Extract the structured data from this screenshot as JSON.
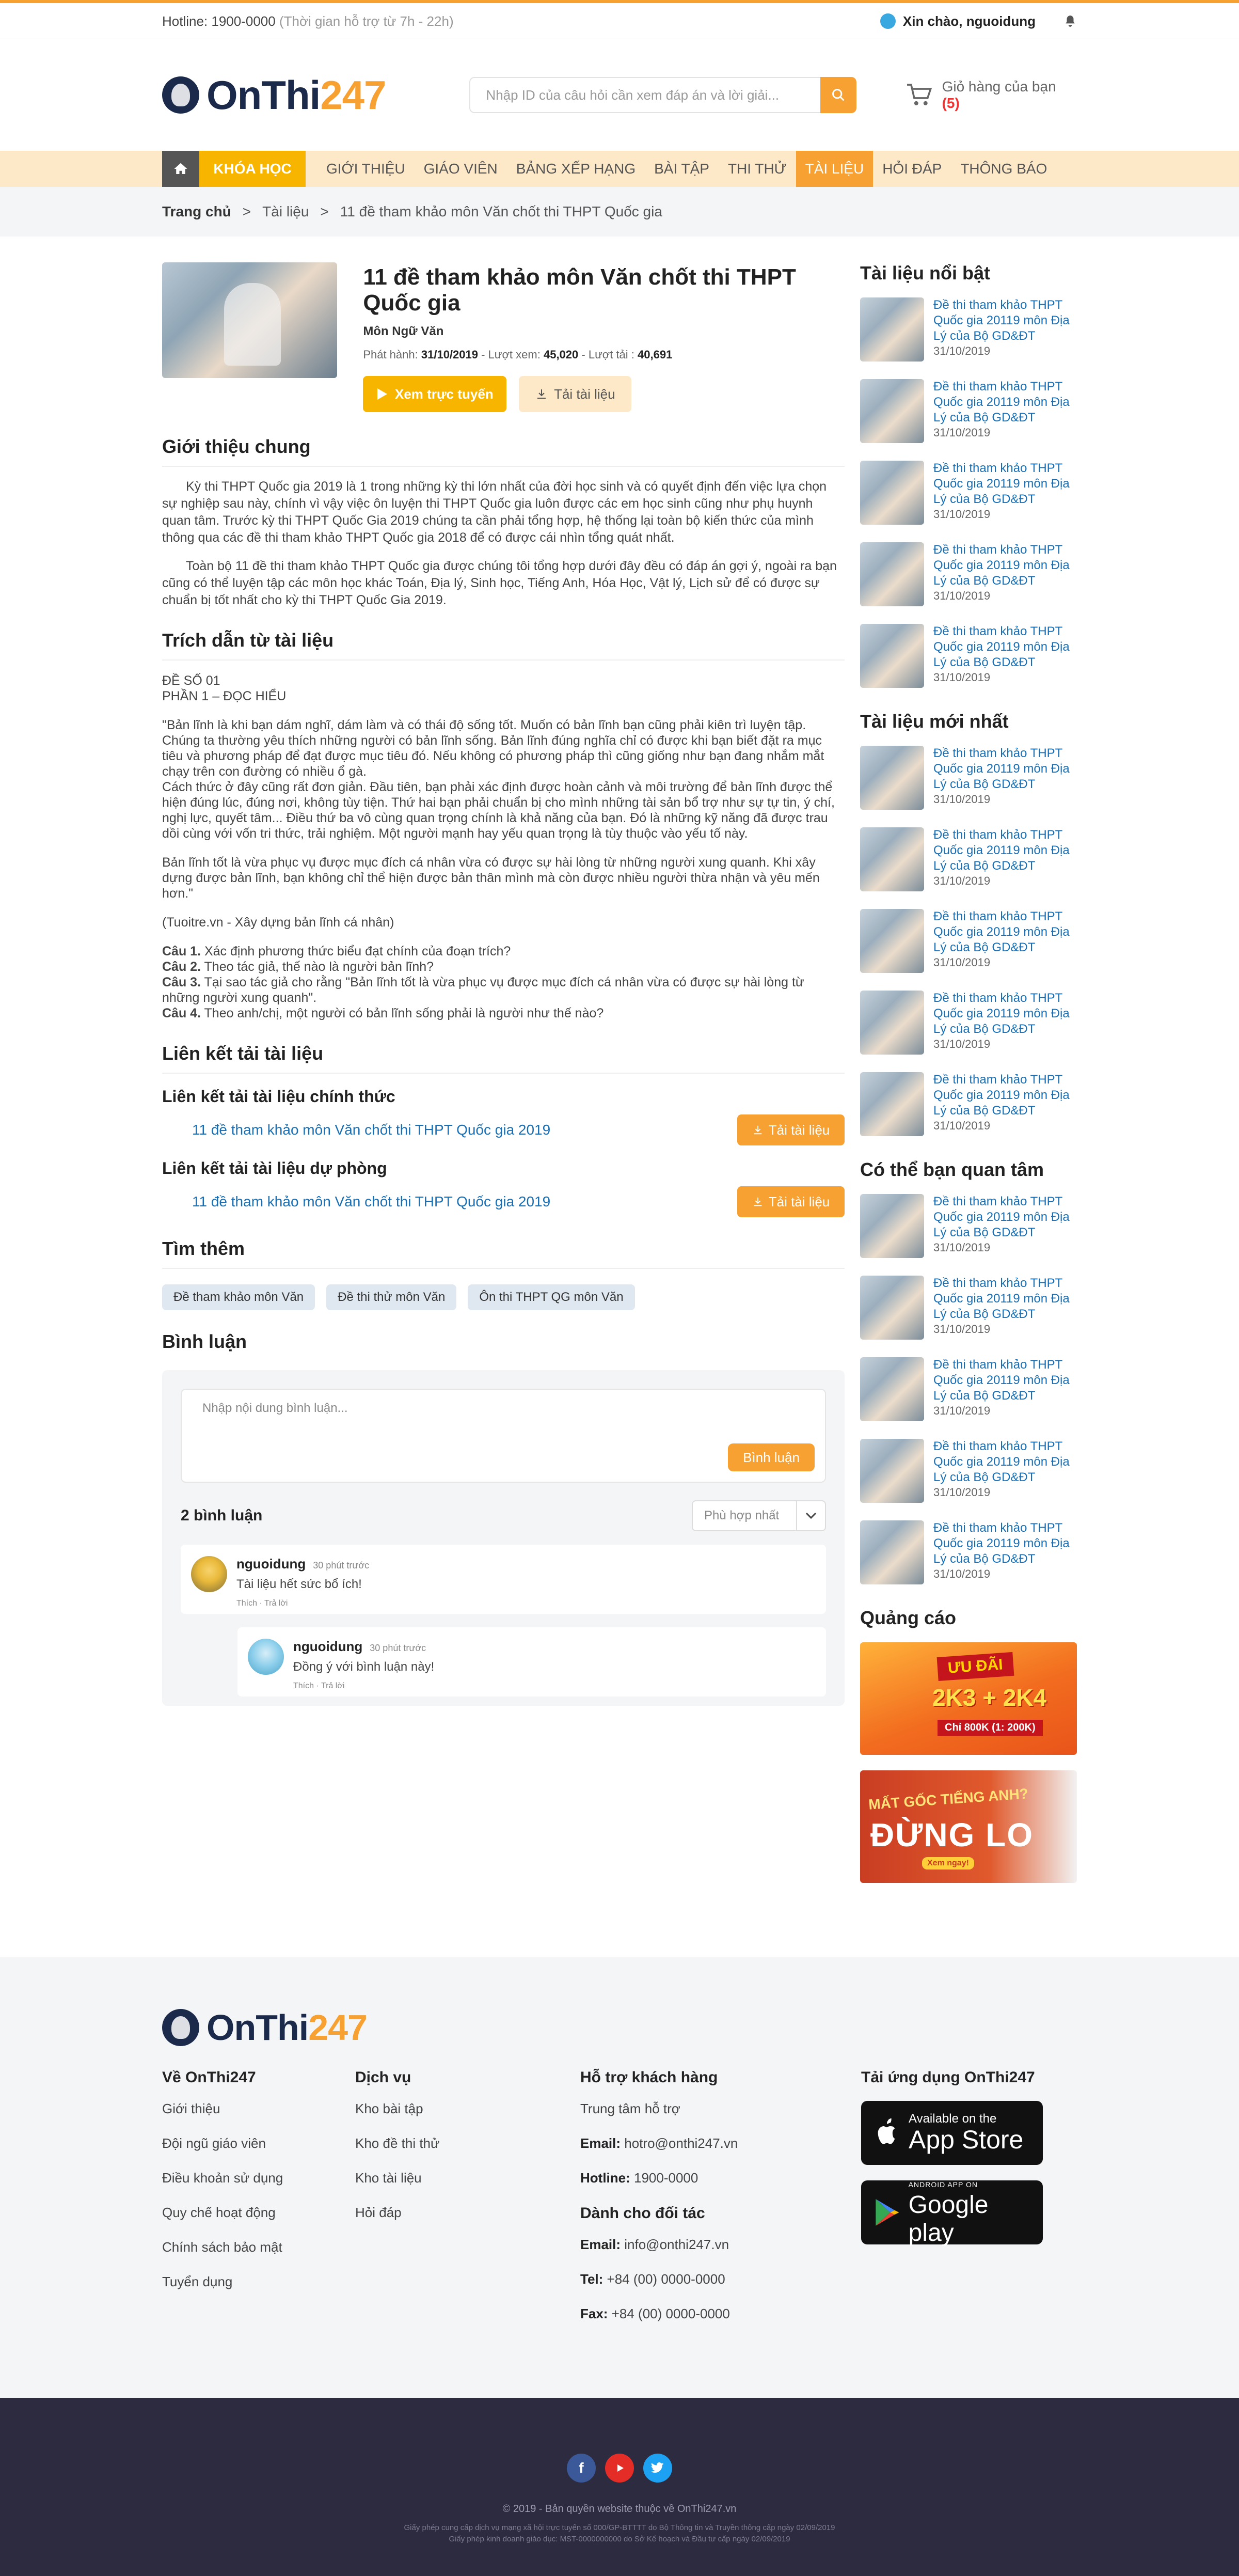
{
  "topbar": {
    "hotline_label": "Hotline: 1900-0000",
    "hotline_hours": "(Thời gian hỗ trợ từ 7h - 22h)",
    "greeting": "Xin chào, nguoidung"
  },
  "header": {
    "logo_text": "OnThi",
    "logo_num": "247",
    "search_placeholder": "Nhập ID của câu hỏi cần xem đáp án và lời giải...",
    "cart_label": "Giỏ hàng của bạn",
    "cart_count": "(5)"
  },
  "nav": {
    "category": "KHÓA HỌC",
    "items": [
      "GIỚI THIỆU",
      "GIÁO VIÊN",
      "BẢNG XẾP HẠNG",
      "BÀI TẬP",
      "THI THỬ",
      "TÀI LIỆU",
      "HỎI ĐÁP",
      "THÔNG BÁO"
    ],
    "active": "TÀI LIỆU"
  },
  "breadcrumb": {
    "home": "Trang chủ",
    "section": "Tài liệu",
    "current": "11 đề tham khảo môn Văn chốt thi THPT Quốc gia"
  },
  "doc": {
    "title": "11 đề tham khảo môn Văn chốt thi THPT Quốc gia",
    "subject": "Môn Ngữ Văn",
    "published_label": "Phát hành:",
    "published": "31/10/2019",
    "views_label": "Lượt xem:",
    "views": "45,020",
    "downloads_label": "Lượt tải :",
    "downloads": "40,691",
    "view_button": "Xem trực tuyến",
    "download_button": "Tải tài liệu"
  },
  "intro": {
    "title": "Giới thiệu chung",
    "p1": "Kỳ thi THPT Quốc gia 2019 là 1 trong những kỳ thi lớn nhất của đời học sinh và có quyết định đến việc lựa chọn sự nghiệp sau này, chính vì vậy việc ôn luyện thi THPT Quốc gia luôn được các em học sinh cũng như phụ huynh quan tâm. Trước kỳ thi THPT Quốc Gia 2019 chúng ta cần phải tổng hợp, hệ thống lại toàn bộ kiến thức của mình thông qua các đề thi tham khảo THPT Quốc gia 2018 để có được cái nhìn tổng quát nhất.",
    "p2": "Toàn bộ 11 đề thi tham khảo THPT Quốc gia được chúng tôi tổng hợp dưới đây đều có đáp án gợi ý, ngoài ra bạn cũng có thể luyện tập các môn học khác Toán, Địa lý, Sinh học, Tiếng Anh, Hóa Học, Vật lý, Lịch sử để có được sự chuẩn bị tốt nhất cho kỳ thi THPT Quốc Gia 2019."
  },
  "excerpt": {
    "title": "Trích dẫn từ tài liệu",
    "l1": "ĐỀ SỐ 01",
    "l2": "PHẦN 1 – ĐỌC HIỂU",
    "p1": "\"Bản lĩnh là khi bạn dám nghĩ, dám làm và có thái độ sống tốt. Muốn có bản lĩnh bạn cũng phải kiên trì luyện tập. Chúng ta thường yêu thích những người có bản lĩnh sống. Bản lĩnh đúng nghĩa chỉ có được khi bạn biết đặt ra mục tiêu và phương pháp để đạt được mục tiêu đó. Nếu không có phương pháp thì cũng giống như bạn đang nhắm mắt chạy trên con đường có nhiều ổ gà.",
    "p2": "Cách thức ở đây cũng rất đơn giản. Đầu tiên, bạn phải xác định được hoàn cảnh và môi trường để bản lĩnh được thể hiện đúng lúc, đúng nơi, không tùy tiện. Thứ hai bạn phải chuẩn bị cho mình những tài sản bổ trợ như sự tự tin, ý chí, nghị lực, quyết tâm... Điều thứ ba vô cùng quan trọng chính là khả năng của bạn. Đó là những kỹ năng đã được trau dồi cùng với vốn tri thức, trải nghiệm. Một người mạnh hay yếu quan trọng là tùy thuộc vào yếu tố này.",
    "p3": "Bản lĩnh tốt là vừa phục vụ được mục đích cá nhân vừa có được sự hài lòng từ những người xung quanh. Khi xây dựng được bản lĩnh, bạn không chỉ thể hiện được bản thân mình mà còn được nhiều người thừa nhận và yêu mến hơn.\"",
    "source": "(Tuoitre.vn - Xây dựng bản lĩnh cá nhân)",
    "questions": [
      {
        "n": "Câu 1.",
        "t": " Xác định phương thức biểu đạt chính của đoạn trích?"
      },
      {
        "n": "Câu 2.",
        "t": " Theo tác giả, thế nào là người bản lĩnh?"
      },
      {
        "n": "Câu 3.",
        "t": " Tại sao tác giả cho rằng \"Bản lĩnh tốt là vừa phục vụ được mục đích cá nhân vừa có được sự hài lòng từ những người xung quanh\"."
      },
      {
        "n": "Câu 4.",
        "t": " Theo anh/chị, một người có bản lĩnh sống phải là người như thế nào?"
      }
    ]
  },
  "links": {
    "title": "Liên kết tải tài liệu",
    "official_title": "Liên kết tải tài liệu chính thức",
    "official_link": "11 đề tham khảo môn Văn chốt thi THPT Quốc gia 2019",
    "backup_title": "Liên kết tải tài liệu dự phòng",
    "backup_link": "11 đề tham khảo môn Văn chốt thi THPT Quốc gia 2019",
    "button": "Tải tài liệu"
  },
  "more": {
    "title": "Tìm thêm",
    "tags": [
      "Đề tham khảo môn Văn",
      "Đề thi thử môn Văn",
      "Ôn thi THPT QG môn Văn"
    ]
  },
  "comments": {
    "title": "Bình luận",
    "placeholder": "Nhập nội dung bình luận...",
    "send": "Bình luận",
    "count": "2 bình luận",
    "sort": "Phù hợp nhất",
    "items": [
      {
        "user": "nguoidung",
        "time": "30 phút trước",
        "text": "Tài liệu hết sức bổ ích!",
        "like": "Thích",
        "reply": "Trả lời"
      },
      {
        "user": "nguoidung",
        "time": "30 phút trước",
        "text": "Đồng ý với bình luận này!",
        "like": "Thích",
        "reply": "Trả lời"
      }
    ]
  },
  "sidebar": {
    "featured_title": "Tài liệu nổi bật",
    "latest_title": "Tài liệu mới nhất",
    "maybe_title": "Có thể bạn quan tâm",
    "ads_title": "Quảng cáo",
    "item_title": "Đề thi tham khảo THPT Quốc gia 20119 môn Địa Lý của Bộ GD&ĐT",
    "item_date": "31/10/2019",
    "ad1": {
      "t1": "ƯU ĐÃI",
      "t2": "2K3 + 2K4",
      "t3": "Chỉ 800K (1: 200K)"
    },
    "ad2": {
      "t1": "MẤT GỐC TIẾNG ANH?",
      "t2": "ĐỪNG LO",
      "t3": "Xem ngay!"
    }
  },
  "footer": {
    "about_title": "Về OnThi247",
    "about": [
      "Giới thiệu",
      "Đội ngũ giáo viên",
      "Điều khoản sử dụng",
      "Quy chế hoạt động",
      "Chính sách bảo mật",
      "Tuyển dụng"
    ],
    "service_title": "Dịch vụ",
    "services": [
      "Kho bài tập",
      "Kho đề thi thử",
      "Kho tài liệu",
      "Hỏi đáp"
    ],
    "support_title": "Hỗ trợ khách hàng",
    "support_center": "Trung tâm hỗ trợ",
    "email_label": "Email:",
    "email": "hotro@onthi247.vn",
    "hotline_label": "Hotline:",
    "hotline": "1900-0000",
    "partner_title": "Dành cho đối tác",
    "p_email_label": "Email:",
    "p_email": "info@onthi247.vn",
    "tel_label": "Tel:",
    "tel": "+84 (00) 0000-0000",
    "fax_label": "Fax:",
    "fax": "+84 (00) 0000-0000",
    "app_title": "Tải ứng dụng OnThi247",
    "appstore_small": "Available on the",
    "appstore_big": "App Store",
    "gplay_small": "ANDROID APP ON",
    "gplay_big": "Google play",
    "copyright": "© 2019 - Bản quyền website thuộc về OnThi247.vn",
    "lic1": "Giấy phép cung cấp dịch vụ mạng xã hội trực tuyến số 000/GP-BTTTT do Bộ Thông tin và Truyền thông cấp ngày 02/09/2019",
    "lic2": "Giấy phép kinh doanh giáo dục: MST-0000000000 do Sở Kế hoạch và Đầu tư cấp ngày 02/09/2019"
  }
}
